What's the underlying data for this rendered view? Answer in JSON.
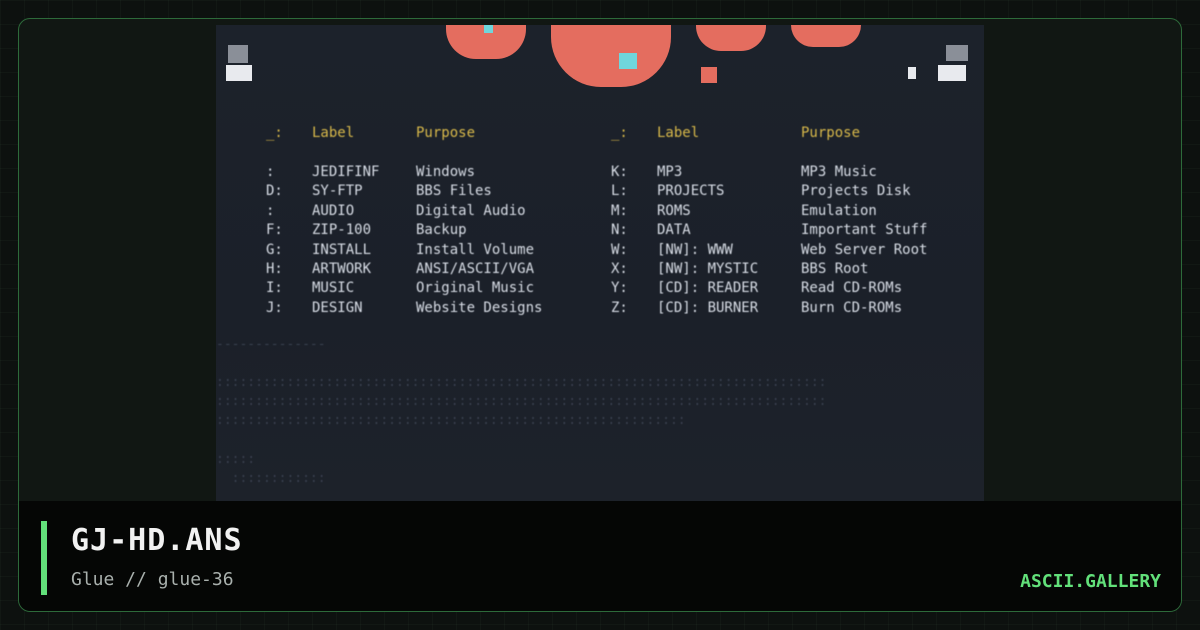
{
  "card": {
    "title": "GJ-HD.ANS",
    "subtitle": "Glue // glue-36",
    "brand": "ASCII.GALLERY",
    "accent_color": "#62e07a"
  },
  "art": {
    "header": {
      "col1_key": "_:",
      "col1_label": "Label",
      "col1_purpose": "Purpose",
      "col2_key": "_:",
      "col2_label": "Label",
      "col2_purpose": "Purpose"
    },
    "rows": [
      {
        "l_key": ":",
        "l_label": "JEDIFINF",
        "l_purpose": "Windows",
        "r_key": "K:",
        "r_label": "MP3",
        "r_purpose": "MP3 Music"
      },
      {
        "l_key": "D:",
        "l_label": "SY-FTP",
        "l_purpose": "BBS Files",
        "r_key": "L:",
        "r_label": "PROJECTS",
        "r_purpose": "Projects Disk"
      },
      {
        "l_key": ":",
        "l_label": "AUDIO",
        "l_purpose": "Digital Audio",
        "r_key": "M:",
        "r_label": "ROMS",
        "r_purpose": "Emulation"
      },
      {
        "l_key": "F:",
        "l_label": "ZIP-100",
        "l_purpose": "Backup",
        "r_key": "N:",
        "r_label": "DATA",
        "r_purpose": "Important Stuff"
      },
      {
        "l_key": "G:",
        "l_label": "INSTALL",
        "l_purpose": "Install Volume",
        "r_key": "W:",
        "r_label": "[NW]: WWW",
        "r_purpose": "Web Server Root"
      },
      {
        "l_key": "H:",
        "l_label": "ARTWORK",
        "l_purpose": "ANSI/ASCII/VGA",
        "r_key": "X:",
        "r_label": "[NW]: MYSTIC",
        "r_purpose": "BBS Root"
      },
      {
        "l_key": "I:",
        "l_label": "MUSIC",
        "l_purpose": "Original Music",
        "r_key": "Y:",
        "r_label": "[CD]: READER",
        "r_purpose": "Read CD-ROMs"
      },
      {
        "l_key": "J:",
        "l_label": "DESIGN",
        "l_purpose": "Website Designs",
        "r_key": "Z:",
        "r_label": "[CD]: BURNER",
        "r_purpose": "Burn CD-ROMs"
      }
    ]
  }
}
